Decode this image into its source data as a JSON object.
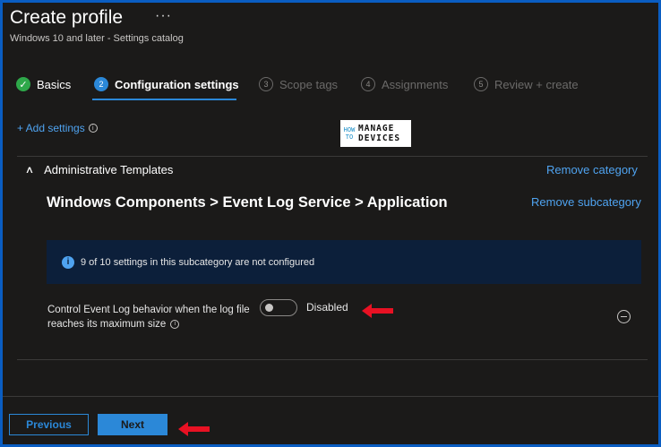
{
  "header": {
    "title": "Create profile",
    "more": "···",
    "subtitle": "Windows 10 and later - Settings catalog"
  },
  "steps": [
    {
      "num": "✓",
      "label": "Basics"
    },
    {
      "num": "2",
      "label": "Configuration settings"
    },
    {
      "num": "3",
      "label": "Scope tags"
    },
    {
      "num": "4",
      "label": "Assignments"
    },
    {
      "num": "5",
      "label": "Review + create"
    }
  ],
  "add_settings": "+ Add settings",
  "logo": {
    "how": "HOW TO",
    "line1": "MANAGE",
    "line2": "DEVICES"
  },
  "category": {
    "name": "Administrative Templates",
    "remove_label": "Remove category",
    "subcategory": "Windows Components > Event Log Service > Application",
    "remove_sub_label": "Remove subcategory"
  },
  "notice": "9 of 10 settings in this subcategory are not configured",
  "setting": {
    "label": "Control Event Log behavior when the log file reaches its maximum size",
    "toggle_state": "Disabled",
    "enabled": false
  },
  "footer": {
    "previous": "Previous",
    "next": "Next"
  },
  "colors": {
    "accent": "#2b88d8",
    "link": "#4fa3f0",
    "success": "#2ea84a",
    "arrow": "#e81123",
    "frame": "#0a5dc2"
  },
  "icons": {
    "info": "info-icon",
    "collapse": "chevron-up-icon",
    "remove": "minus-circle-icon",
    "annotation": "red-arrow-left-icon"
  }
}
